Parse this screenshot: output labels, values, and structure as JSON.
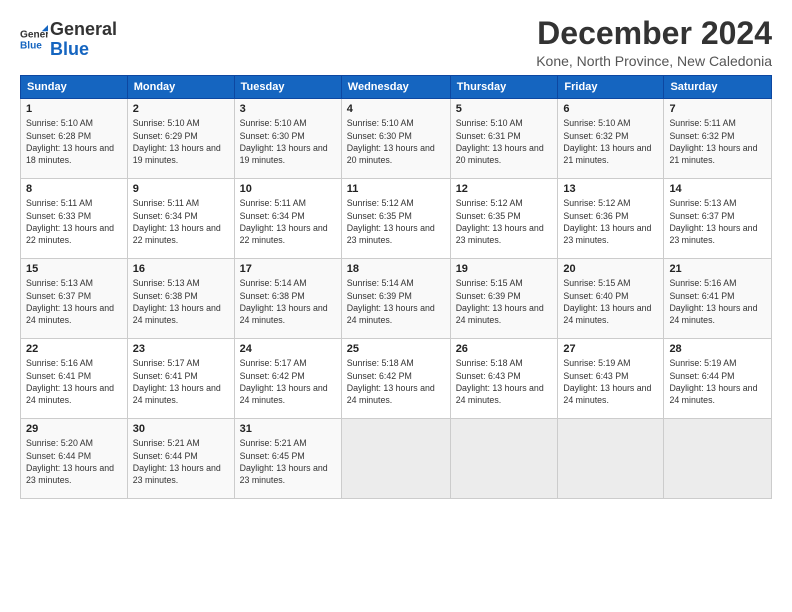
{
  "logo": {
    "name_general": "General",
    "name_blue": "Blue"
  },
  "title": "December 2024",
  "subtitle": "Kone, North Province, New Caledonia",
  "header_days": [
    "Sunday",
    "Monday",
    "Tuesday",
    "Wednesday",
    "Thursday",
    "Friday",
    "Saturday"
  ],
  "weeks": [
    [
      {
        "day": "1",
        "sunrise": "Sunrise: 5:10 AM",
        "sunset": "Sunset: 6:28 PM",
        "daylight": "Daylight: 13 hours and 18 minutes."
      },
      {
        "day": "2",
        "sunrise": "Sunrise: 5:10 AM",
        "sunset": "Sunset: 6:29 PM",
        "daylight": "Daylight: 13 hours and 19 minutes."
      },
      {
        "day": "3",
        "sunrise": "Sunrise: 5:10 AM",
        "sunset": "Sunset: 6:30 PM",
        "daylight": "Daylight: 13 hours and 19 minutes."
      },
      {
        "day": "4",
        "sunrise": "Sunrise: 5:10 AM",
        "sunset": "Sunset: 6:30 PM",
        "daylight": "Daylight: 13 hours and 20 minutes."
      },
      {
        "day": "5",
        "sunrise": "Sunrise: 5:10 AM",
        "sunset": "Sunset: 6:31 PM",
        "daylight": "Daylight: 13 hours and 20 minutes."
      },
      {
        "day": "6",
        "sunrise": "Sunrise: 5:10 AM",
        "sunset": "Sunset: 6:32 PM",
        "daylight": "Daylight: 13 hours and 21 minutes."
      },
      {
        "day": "7",
        "sunrise": "Sunrise: 5:11 AM",
        "sunset": "Sunset: 6:32 PM",
        "daylight": "Daylight: 13 hours and 21 minutes."
      }
    ],
    [
      {
        "day": "8",
        "sunrise": "Sunrise: 5:11 AM",
        "sunset": "Sunset: 6:33 PM",
        "daylight": "Daylight: 13 hours and 22 minutes."
      },
      {
        "day": "9",
        "sunrise": "Sunrise: 5:11 AM",
        "sunset": "Sunset: 6:34 PM",
        "daylight": "Daylight: 13 hours and 22 minutes."
      },
      {
        "day": "10",
        "sunrise": "Sunrise: 5:11 AM",
        "sunset": "Sunset: 6:34 PM",
        "daylight": "Daylight: 13 hours and 22 minutes."
      },
      {
        "day": "11",
        "sunrise": "Sunrise: 5:12 AM",
        "sunset": "Sunset: 6:35 PM",
        "daylight": "Daylight: 13 hours and 23 minutes."
      },
      {
        "day": "12",
        "sunrise": "Sunrise: 5:12 AM",
        "sunset": "Sunset: 6:35 PM",
        "daylight": "Daylight: 13 hours and 23 minutes."
      },
      {
        "day": "13",
        "sunrise": "Sunrise: 5:12 AM",
        "sunset": "Sunset: 6:36 PM",
        "daylight": "Daylight: 13 hours and 23 minutes."
      },
      {
        "day": "14",
        "sunrise": "Sunrise: 5:13 AM",
        "sunset": "Sunset: 6:37 PM",
        "daylight": "Daylight: 13 hours and 23 minutes."
      }
    ],
    [
      {
        "day": "15",
        "sunrise": "Sunrise: 5:13 AM",
        "sunset": "Sunset: 6:37 PM",
        "daylight": "Daylight: 13 hours and 24 minutes."
      },
      {
        "day": "16",
        "sunrise": "Sunrise: 5:13 AM",
        "sunset": "Sunset: 6:38 PM",
        "daylight": "Daylight: 13 hours and 24 minutes."
      },
      {
        "day": "17",
        "sunrise": "Sunrise: 5:14 AM",
        "sunset": "Sunset: 6:38 PM",
        "daylight": "Daylight: 13 hours and 24 minutes."
      },
      {
        "day": "18",
        "sunrise": "Sunrise: 5:14 AM",
        "sunset": "Sunset: 6:39 PM",
        "daylight": "Daylight: 13 hours and 24 minutes."
      },
      {
        "day": "19",
        "sunrise": "Sunrise: 5:15 AM",
        "sunset": "Sunset: 6:39 PM",
        "daylight": "Daylight: 13 hours and 24 minutes."
      },
      {
        "day": "20",
        "sunrise": "Sunrise: 5:15 AM",
        "sunset": "Sunset: 6:40 PM",
        "daylight": "Daylight: 13 hours and 24 minutes."
      },
      {
        "day": "21",
        "sunrise": "Sunrise: 5:16 AM",
        "sunset": "Sunset: 6:41 PM",
        "daylight": "Daylight: 13 hours and 24 minutes."
      }
    ],
    [
      {
        "day": "22",
        "sunrise": "Sunrise: 5:16 AM",
        "sunset": "Sunset: 6:41 PM",
        "daylight": "Daylight: 13 hours and 24 minutes."
      },
      {
        "day": "23",
        "sunrise": "Sunrise: 5:17 AM",
        "sunset": "Sunset: 6:41 PM",
        "daylight": "Daylight: 13 hours and 24 minutes."
      },
      {
        "day": "24",
        "sunrise": "Sunrise: 5:17 AM",
        "sunset": "Sunset: 6:42 PM",
        "daylight": "Daylight: 13 hours and 24 minutes."
      },
      {
        "day": "25",
        "sunrise": "Sunrise: 5:18 AM",
        "sunset": "Sunset: 6:42 PM",
        "daylight": "Daylight: 13 hours and 24 minutes."
      },
      {
        "day": "26",
        "sunrise": "Sunrise: 5:18 AM",
        "sunset": "Sunset: 6:43 PM",
        "daylight": "Daylight: 13 hours and 24 minutes."
      },
      {
        "day": "27",
        "sunrise": "Sunrise: 5:19 AM",
        "sunset": "Sunset: 6:43 PM",
        "daylight": "Daylight: 13 hours and 24 minutes."
      },
      {
        "day": "28",
        "sunrise": "Sunrise: 5:19 AM",
        "sunset": "Sunset: 6:44 PM",
        "daylight": "Daylight: 13 hours and 24 minutes."
      }
    ],
    [
      {
        "day": "29",
        "sunrise": "Sunrise: 5:20 AM",
        "sunset": "Sunset: 6:44 PM",
        "daylight": "Daylight: 13 hours and 23 minutes."
      },
      {
        "day": "30",
        "sunrise": "Sunrise: 5:21 AM",
        "sunset": "Sunset: 6:44 PM",
        "daylight": "Daylight: 13 hours and 23 minutes."
      },
      {
        "day": "31",
        "sunrise": "Sunrise: 5:21 AM",
        "sunset": "Sunset: 6:45 PM",
        "daylight": "Daylight: 13 hours and 23 minutes."
      },
      null,
      null,
      null,
      null
    ]
  ]
}
